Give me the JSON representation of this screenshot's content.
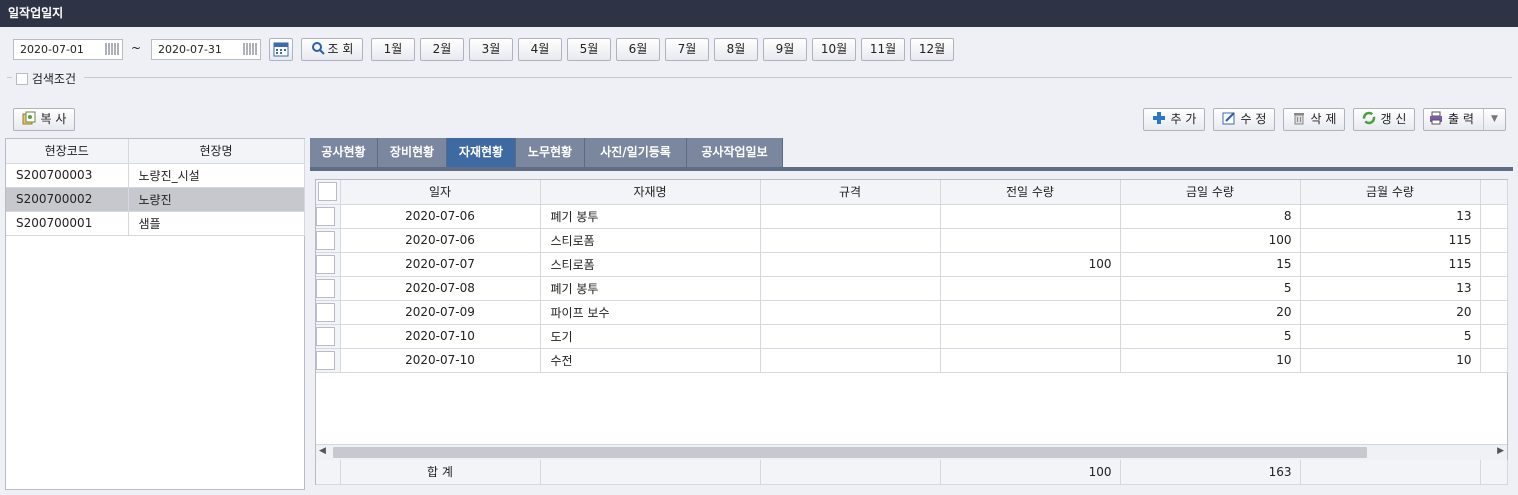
{
  "window": {
    "title": "일작업일지"
  },
  "filter": {
    "date_from": "2020-07-01",
    "date_to": "2020-07-31",
    "tilde": "~",
    "search_label": "조 회",
    "months": [
      "1월",
      "2월",
      "3월",
      "4월",
      "5월",
      "6월",
      "7월",
      "8월",
      "9월",
      "10월",
      "11월",
      "12월"
    ],
    "search_conditions_label": "검색조건"
  },
  "toolbar": {
    "copy_label": "복 사",
    "add_label": "추 가",
    "edit_label": "수 정",
    "delete_label": "삭 제",
    "refresh_label": "갱 신",
    "print_label": "출 력"
  },
  "site_list": {
    "headers": {
      "code": "현장코드",
      "name": "현장명"
    },
    "rows": [
      {
        "code": "S200700003",
        "name": "노량진_시설"
      },
      {
        "code": "S200700002",
        "name": "노량진"
      },
      {
        "code": "S200700001",
        "name": "샘플"
      }
    ],
    "selected_index": 1
  },
  "tabs": [
    "공사현황",
    "장비현황",
    "자재현황",
    "노무현황",
    "사진/일기등록",
    "공사작업일보"
  ],
  "active_tab": 2,
  "material_grid": {
    "headers": {
      "date": "일자",
      "name": "자재명",
      "spec": "규격",
      "prev_qty": "전일 수량",
      "today_qty": "금일 수량",
      "month_qty": "금월 수량"
    },
    "rows": [
      {
        "date": "2020-07-06",
        "name": "폐기 봉투",
        "spec": "",
        "prev_qty": "",
        "today_qty": "8",
        "month_qty": "13"
      },
      {
        "date": "2020-07-06",
        "name": "스티로폼",
        "spec": "",
        "prev_qty": "",
        "today_qty": "100",
        "month_qty": "115"
      },
      {
        "date": "2020-07-07",
        "name": "스티로폼",
        "spec": "",
        "prev_qty": "100",
        "today_qty": "15",
        "month_qty": "115"
      },
      {
        "date": "2020-07-08",
        "name": "폐기 봉투",
        "spec": "",
        "prev_qty": "",
        "today_qty": "5",
        "month_qty": "13"
      },
      {
        "date": "2020-07-09",
        "name": "파이프 보수",
        "spec": "",
        "prev_qty": "",
        "today_qty": "20",
        "month_qty": "20"
      },
      {
        "date": "2020-07-10",
        "name": "도기",
        "spec": "",
        "prev_qty": "",
        "today_qty": "5",
        "month_qty": "5"
      },
      {
        "date": "2020-07-10",
        "name": "수전",
        "spec": "",
        "prev_qty": "",
        "today_qty": "10",
        "month_qty": "10"
      }
    ],
    "footer": {
      "label": "합 계",
      "prev_qty_total": "100",
      "today_qty_total": "163"
    }
  }
}
